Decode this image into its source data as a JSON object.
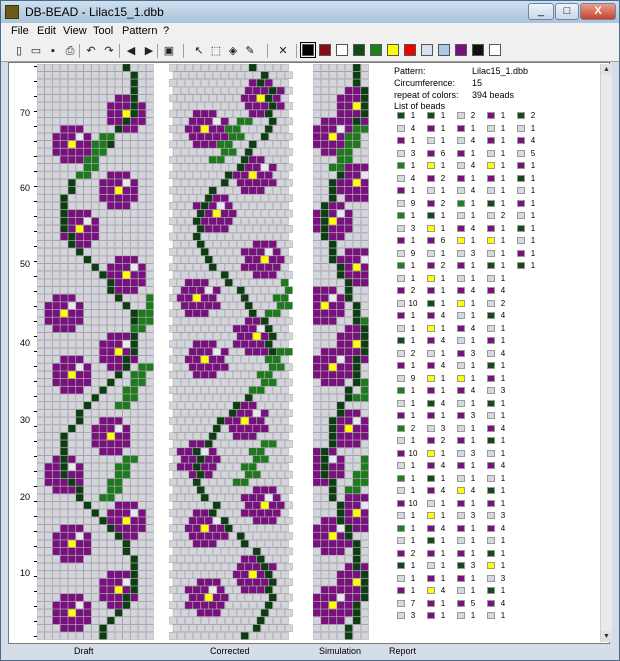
{
  "window": {
    "title": "DB-BEAD - Lilac15_1.dbb",
    "min": "_",
    "max": "□",
    "close": "X"
  },
  "menu": [
    "File",
    "Edit",
    "View",
    "Tool",
    "Pattern",
    "?"
  ],
  "toolbar": {
    "icons": [
      "new-icon",
      "open-icon",
      "save-icon",
      "print-icon",
      "undo-icon",
      "redo-icon",
      "arrow-left-icon",
      "arrow-right-icon",
      "copy-icon",
      "pointer-icon",
      "select-rect-icon",
      "fill-icon",
      "picker-icon",
      "delete-icon"
    ],
    "glyphs": [
      "▯",
      "▭",
      "▪",
      "⎙",
      "↶",
      "↷",
      "◀",
      "▶",
      "▣",
      "↖",
      "⬚",
      "◈",
      "✎",
      "✕"
    ]
  },
  "palette": [
    "#000000",
    "#8b0a1a",
    "#ffffff",
    "#0e4a1a",
    "#1f7f1f",
    "#ffff00",
    "#ee0000",
    "#d8e0f0",
    "#b0c8e8",
    "#7a1080",
    "#101010",
    "#ffffff"
  ],
  "colors": {
    "bg": "#d4d4dc",
    "purple": "#7a1080",
    "dark": "#0d3d12",
    "green": "#1e7a1e",
    "yellow": "#ffff00",
    "white": "#e8e8f0"
  },
  "ruler": [
    "70",
    "60",
    "50",
    "40",
    "30",
    "20",
    "10"
  ],
  "panels": {
    "draft": "Draft",
    "corrected": "Corrected",
    "simulation": "Simulation",
    "report": "Report"
  },
  "report": {
    "pattern_label": "Pattern:",
    "pattern_value": "Lilac15_1.dbb",
    "circ_label": "Circumference:",
    "circ_value": "15",
    "repeat_label": "repeat of colors:",
    "repeat_value": "394 beads",
    "list_label": "List of beads"
  },
  "bead_columns": [
    [
      "1",
      "4",
      "1",
      "3",
      "1",
      "4",
      "1",
      "9",
      "1",
      "3",
      "1",
      "9",
      "1",
      "1",
      "2",
      "10",
      "1",
      "1",
      "1",
      "2",
      "1",
      "9",
      "1",
      "1",
      "1",
      "2",
      "1",
      "10",
      "1",
      "1",
      "1",
      "10",
      "1",
      "1",
      "1",
      "2",
      "1",
      "1",
      "1",
      "7",
      "3"
    ],
    [
      "1",
      "1",
      "1",
      "6",
      "1",
      "2",
      "1",
      "2",
      "1",
      "1",
      "6",
      "1",
      "2",
      "1",
      "1",
      "1",
      "4",
      "1",
      "4",
      "1",
      "4",
      "1",
      "1",
      "4",
      "1",
      "3",
      "2",
      "1",
      "4",
      "1",
      "4",
      "1",
      "1",
      "4",
      "1",
      "1",
      "1",
      "1",
      "4",
      "1",
      "1"
    ],
    [
      "2",
      "1",
      "4",
      "1",
      "4",
      "1",
      "4",
      "1",
      "1",
      "4",
      "1",
      "3",
      "1",
      "1",
      "4",
      "1",
      "1",
      "4",
      "1",
      "3",
      "1",
      "1",
      "4",
      "1",
      "3",
      "1",
      "1",
      "3",
      "1",
      "1",
      "4",
      "1",
      "3",
      "1",
      "1",
      "1",
      "3",
      "1",
      "1",
      "5",
      "1"
    ],
    [
      "1",
      "1",
      "1",
      "1",
      "1",
      "1",
      "1",
      "1",
      "2",
      "1",
      "1",
      "1",
      "1",
      "1",
      "4",
      "2",
      "4",
      "1",
      "1",
      "4",
      "1",
      "1",
      "3",
      "1",
      "1",
      "4",
      "1",
      "1",
      "4",
      "1",
      "1",
      "1",
      "3",
      "4",
      "1",
      "1",
      "1",
      "3",
      "1",
      "4",
      "1"
    ],
    [
      "2",
      "1",
      "4",
      "5",
      "1",
      "1",
      "1",
      "1",
      "1",
      "1",
      "1",
      "1",
      "1"
    ]
  ],
  "bead_colors": [
    [
      "#0e4a1a",
      "#d8d8e0",
      "#7a1080",
      "#d8d8e0",
      "#1f7f1f",
      "#d8d8e0",
      "#7a1080",
      "#d8d8e0",
      "#1f7f1f",
      "#d8d8e0",
      "#7a1080",
      "#d8d8e0",
      "#1f7f1f",
      "#d8d8e0",
      "#7a1080",
      "#d8d8e0",
      "#7a1080",
      "#d8d8e0",
      "#0e4a1a",
      "#d8d8e0",
      "#7a1080",
      "#d8d8e0",
      "#1f7f1f",
      "#d8d8e0",
      "#7a1080",
      "#1f7f1f",
      "#d8d8e0",
      "#7a1080",
      "#d8d8e0",
      "#1f7f1f",
      "#d8d8e0",
      "#7a1080",
      "#d8d8e0",
      "#1f7f1f",
      "#d8d8e0",
      "#7a1080",
      "#0e4a1a",
      "#d8d8e0",
      "#7a1080",
      "#d8d8e0",
      "#d8d8e0"
    ],
    [
      "#0e4a1a",
      "#7a1080",
      "#d8d8e0",
      "#7a1080",
      "#ffff00",
      "#7a1080",
      "#d8d8e0",
      "#7a1080",
      "#0e4a1a",
      "#ffff00",
      "#7a1080",
      "#d8d8e0",
      "#7a1080",
      "#ffff00",
      "#7a1080",
      "#0e4a1a",
      "#7a1080",
      "#ffff00",
      "#7a1080",
      "#d8d8e0",
      "#7a1080",
      "#ffff00",
      "#7a1080",
      "#0e4a1a",
      "#7a1080",
      "#d8d8e0",
      "#7a1080",
      "#ffff00",
      "#7a1080",
      "#0e4a1a",
      "#7a1080",
      "#d8d8e0",
      "#ffff00",
      "#7a1080",
      "#0e4a1a",
      "#7a1080",
      "#d8d8e0",
      "#7a1080",
      "#ffff00",
      "#7a1080",
      "#7a1080"
    ],
    [
      "#d8d8e0",
      "#7a1080",
      "#d8d8e0",
      "#7a1080",
      "#d8d8e0",
      "#7a1080",
      "#d8d8e0",
      "#1f7f1f",
      "#d8d8e0",
      "#7a1080",
      "#ffff00",
      "#d8d8e0",
      "#7a1080",
      "#d8d8e0",
      "#7a1080",
      "#ffff00",
      "#d8d8e0",
      "#7a1080",
      "#d8d8e0",
      "#7a1080",
      "#d8d8e0",
      "#ffff00",
      "#7a1080",
      "#d8d8e0",
      "#7a1080",
      "#d8d8e0",
      "#7a1080",
      "#d8d8e0",
      "#7a1080",
      "#d8d8e0",
      "#ffff00",
      "#7a1080",
      "#d8d8e0",
      "#7a1080",
      "#d8d8e0",
      "#7a1080",
      "#0e4a1a",
      "#7a1080",
      "#d8d8e0",
      "#7a1080",
      "#d8d8e0"
    ],
    [
      "#7a1080",
      "#d8d8e0",
      "#7a1080",
      "#d8d8e0",
      "#ffff00",
      "#7a1080",
      "#d8d8e0",
      "#0e4a1a",
      "#d8d8e0",
      "#7a1080",
      "#ffff00",
      "#d8d8e0",
      "#0e4a1a",
      "#d8d8e0",
      "#7a1080",
      "#d8d8e0",
      "#0e4a1a",
      "#d8d8e0",
      "#7a1080",
      "#d8d8e0",
      "#0e4a1a",
      "#7a1080",
      "#d8d8e0",
      "#0e4a1a",
      "#d8d8e0",
      "#7a1080",
      "#0e4a1a",
      "#d8d8e0",
      "#7a1080",
      "#d8d8e0",
      "#0e4a1a",
      "#7a1080",
      "#d8d8e0",
      "#7a1080",
      "#d8d8e0",
      "#0e4a1a",
      "#ffff00",
      "#d8d8e0",
      "#0e4a1a",
      "#7a1080",
      "#d8d8e0"
    ],
    [
      "#0e4a1a",
      "#d8d8e0",
      "#7a1080",
      "#d8d8e0",
      "#7a1080",
      "#0e4a1a",
      "#d8d8e0",
      "#7a1080",
      "#d8d8e0",
      "#0e4a1a",
      "#d8d8e0",
      "#7a1080",
      "#0e4a1a"
    ]
  ]
}
